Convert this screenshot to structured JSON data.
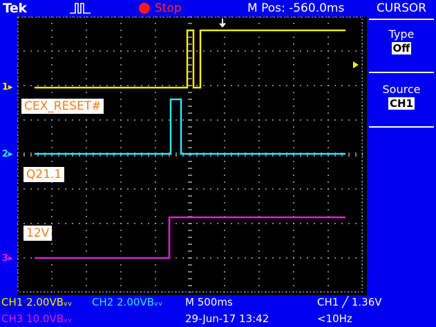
{
  "header": {
    "brand": "Tek",
    "trigger_icon": "trigger-pulse-icon",
    "status": "Stop",
    "m_pos": "M Pos: -560.0ms"
  },
  "menu": {
    "title": "CURSOR",
    "type_label": "Type",
    "type_value": "Off",
    "source_label": "Source",
    "source_value": "CH1"
  },
  "channels": {
    "ch1_marker": "1",
    "ch2_marker": "2",
    "ch3_marker": "3"
  },
  "labels": {
    "ch1": "CEX_RESET#",
    "ch2": "Q21.1",
    "ch3": "12V"
  },
  "footer": {
    "ch1_name": "CH1",
    "ch1_scale": "2.00VBᵥᵥ",
    "ch2_name": "CH2",
    "ch2_scale": "2.00VBᵥᵥ",
    "timebase": "M 500ms",
    "trigger": "CH1 ╱ 1.36V",
    "ch3_name": "CH3",
    "ch3_scale": "10.0VBᵥᵥ",
    "date": "29-Jun-17 13:42",
    "freq": "<10Hz"
  },
  "colors": {
    "ch1": "#f5f000",
    "ch2": "#2ee8f0",
    "ch3": "#e020e0",
    "bg": "#0000f0",
    "grid": "#c8c8c8",
    "label_text": "#ff7a1a"
  }
}
